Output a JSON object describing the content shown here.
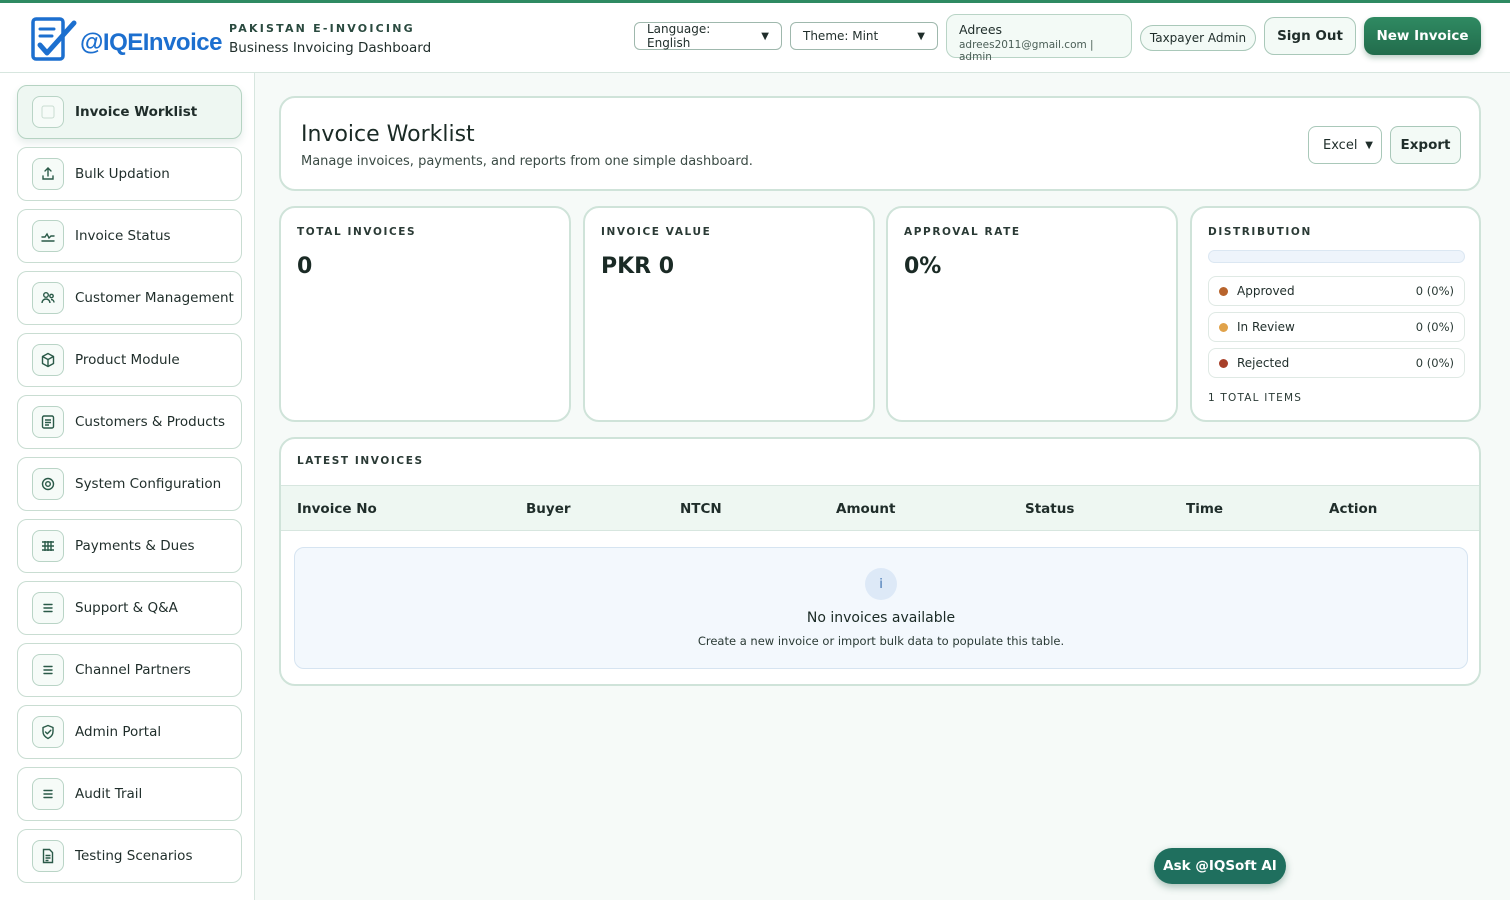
{
  "header": {
    "brand": "@IQEInvoice",
    "eyebrow": "PAKISTAN E-INVOICING",
    "subtitle": "Business Invoicing Dashboard",
    "language_select": "Language: English",
    "theme_select": "Theme: Mint",
    "user_name": "Adrees",
    "user_email_role": "adrees2011@gmail.com | admin",
    "role_pill": "Taxpayer Admin",
    "sign_out": "Sign Out",
    "new_invoice": "New Invoice"
  },
  "sidebar": {
    "items": [
      {
        "label": "Invoice Worklist",
        "icon": "grid-icon"
      },
      {
        "label": "Bulk Updation",
        "icon": "upload-icon"
      },
      {
        "label": "Invoice Status",
        "icon": "activity-icon"
      },
      {
        "label": "Customer Management",
        "icon": "users-icon"
      },
      {
        "label": "Product Module",
        "icon": "box-icon"
      },
      {
        "label": "Customers & Products",
        "icon": "list-card-icon"
      },
      {
        "label": "System Configuration",
        "icon": "settings-icon"
      },
      {
        "label": "Payments & Dues",
        "icon": "table-icon"
      },
      {
        "label": "Support & Q&A",
        "icon": "menu-icon"
      },
      {
        "label": "Channel Partners",
        "icon": "menu-icon"
      },
      {
        "label": "Admin Portal",
        "icon": "shield-check-icon"
      },
      {
        "label": "Audit Trail",
        "icon": "menu-icon"
      },
      {
        "label": "Testing Scenarios",
        "icon": "document-icon"
      }
    ]
  },
  "main": {
    "title": "Invoice Worklist",
    "description": "Manage invoices, payments, and reports from one simple dashboard.",
    "export_format": "Excel",
    "export_button": "Export",
    "stats": [
      {
        "label": "TOTAL INVOICES",
        "value": "0"
      },
      {
        "label": "INVOICE VALUE",
        "value": "PKR 0"
      },
      {
        "label": "APPROVAL RATE",
        "value": "0%"
      }
    ],
    "distribution": {
      "label": "DISTRIBUTION",
      "rows": [
        {
          "name": "Approved",
          "value": "0 (0%)",
          "color": "#b8642c"
        },
        {
          "name": "In Review",
          "value": "0 (0%)",
          "color": "#e0a24a"
        },
        {
          "name": "Rejected",
          "value": "0 (0%)",
          "color": "#a8402a"
        }
      ],
      "total": "1 TOTAL ITEMS"
    },
    "latest": {
      "label": "LATEST INVOICES",
      "columns": [
        "Invoice No",
        "Buyer",
        "NTCN",
        "Amount",
        "Status",
        "Time",
        "Action"
      ],
      "empty_icon": "i",
      "empty_title": "No invoices available",
      "empty_desc": "Create a new invoice or import bulk data to populate this table."
    }
  },
  "assistant_button": "Ask @IQSoft AI",
  "colors": {
    "accent": "#2e8a62",
    "brand": "#1c6fcf"
  }
}
